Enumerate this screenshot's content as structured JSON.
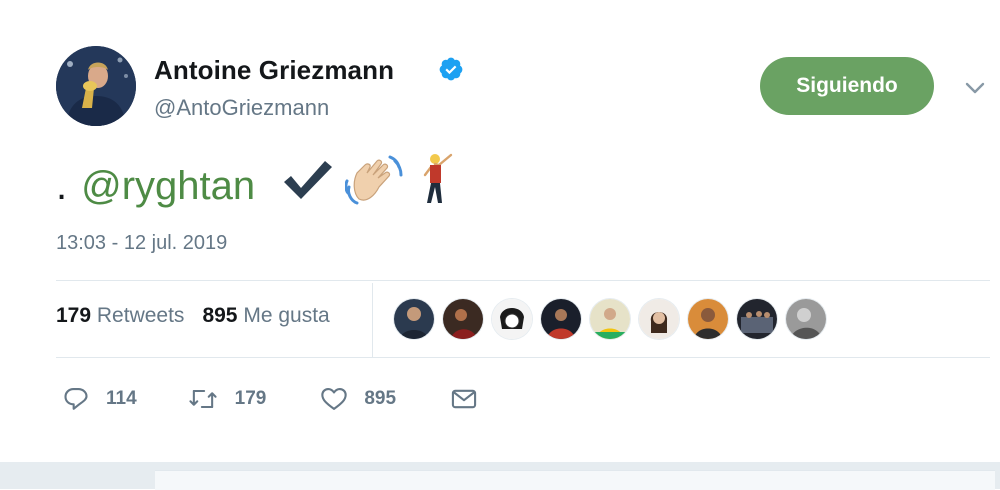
{
  "author": {
    "name": "Antoine Griezmann",
    "handle": "@AntoGriezmann",
    "verified": true,
    "avatar_icon": "avatar-photo"
  },
  "follow_button": {
    "label": "Siguiendo",
    "color": "#6aa263"
  },
  "menu_icon": "chevron-down-icon",
  "tweet": {
    "prefix": ".",
    "mention": "@ryghtan",
    "mention_color": "#4e8b45",
    "emojis": [
      "heavy-check-mark",
      "waving-hand",
      "dancer"
    ],
    "timestamp": "13:03 - 12 jul. 2019"
  },
  "stats": {
    "retweets_count": "179",
    "retweets_label": "Retweets",
    "likes_count": "895",
    "likes_label": "Me gusta"
  },
  "liked_by_avatars": 9,
  "actions": {
    "reply_count": "114",
    "retweet_count": "179",
    "like_count": "895"
  }
}
